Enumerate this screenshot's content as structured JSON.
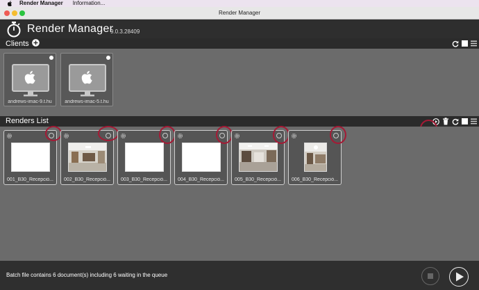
{
  "menubar": {
    "app_name": "Render Manager",
    "items": [
      "Information..."
    ]
  },
  "window": {
    "title": "Render Manager"
  },
  "header": {
    "title": "Render Manager",
    "version": "9.0.3.28409"
  },
  "clients": {
    "title": "Clients",
    "items": [
      {
        "name": "andrews-imac-9.t.hu"
      },
      {
        "name": "andrews-imac-5.t.hu"
      }
    ]
  },
  "renders": {
    "title": "Renders List",
    "items": [
      {
        "name": "001_B30_Recepció...",
        "thumb": "blank"
      },
      {
        "name": "002_B30_Recepció...",
        "thumb": "room"
      },
      {
        "name": "003_B30_Recepció...",
        "thumb": "blank"
      },
      {
        "name": "004_B30_Recepció...",
        "thumb": "blank"
      },
      {
        "name": "005_B30_Recepció...",
        "thumb": "room"
      },
      {
        "name": "006_B30_Recepció...",
        "thumb": "room-portrait"
      }
    ]
  },
  "status": {
    "message": "Batch file contains 6 document(s) including 6 waiting in the queue"
  },
  "colors": {
    "highlight": "#a51a35",
    "panel": "#6b6b6b",
    "bar": "#2b2b2b"
  }
}
